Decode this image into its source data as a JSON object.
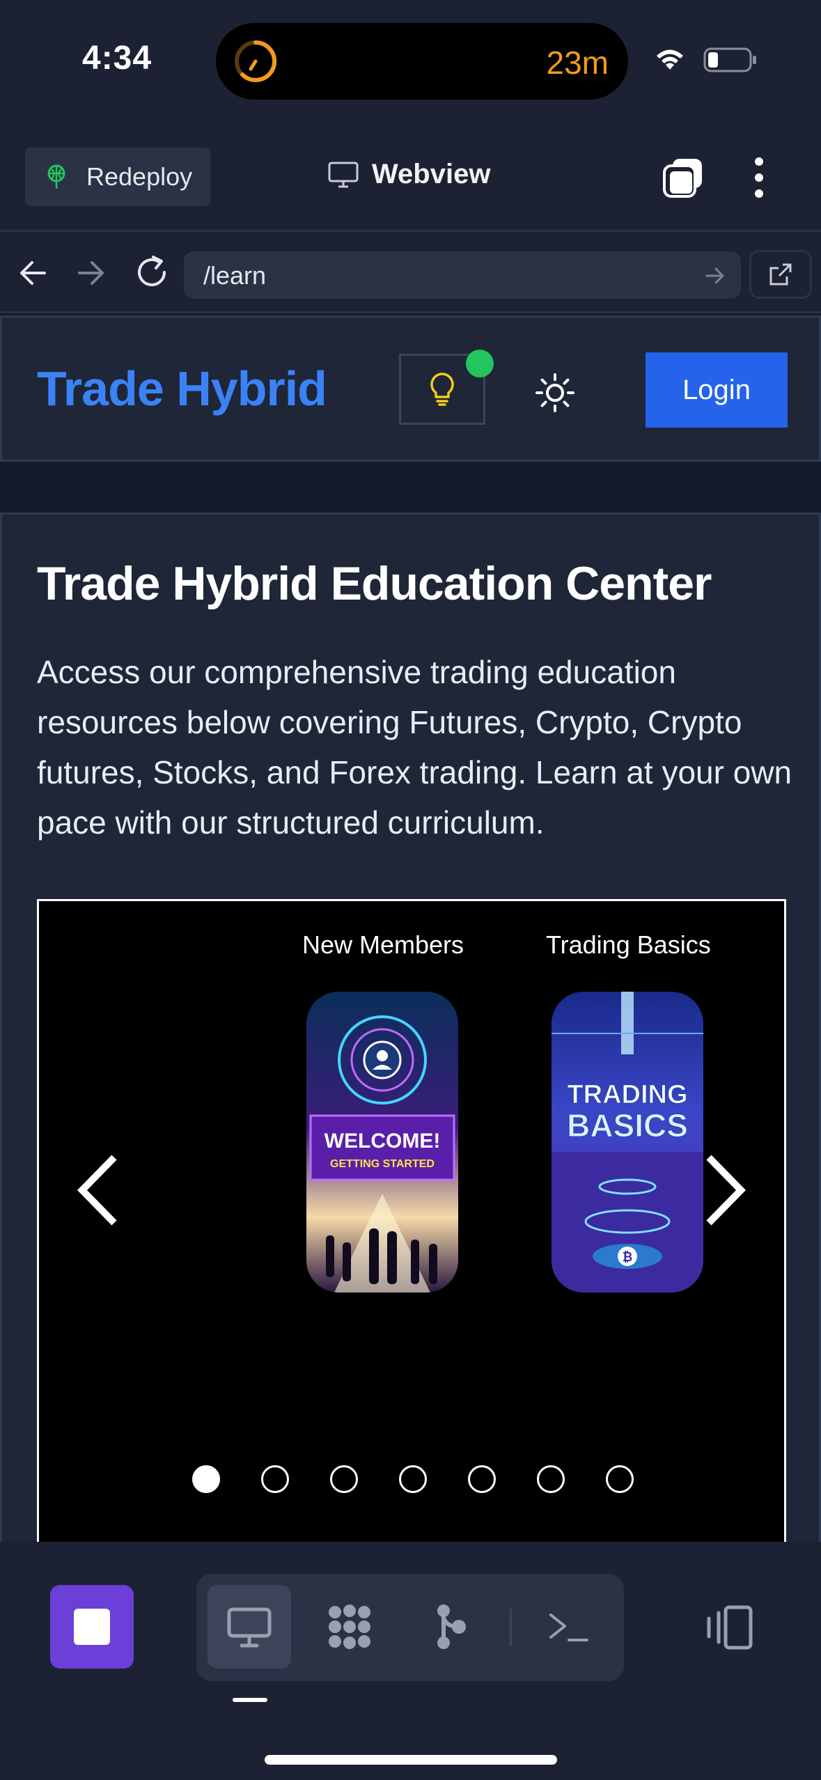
{
  "status_bar": {
    "time": "4:34",
    "timer": "23m",
    "timer_color": "#f39a1c"
  },
  "replit_bar": {
    "redeploy_label": "Redeploy",
    "webview_label": "Webview",
    "icons": [
      "redeploy-icon",
      "monitor-icon",
      "tabs-icon",
      "more-vertical-icon"
    ]
  },
  "url_bar": {
    "url": "/learn",
    "icons": [
      "back-arrow-icon",
      "forward-arrow-icon",
      "reload-icon",
      "go-arrow-icon",
      "open-external-icon"
    ]
  },
  "site_header": {
    "brand": "Trade Hybrid",
    "login_label": "Login",
    "brand_color": "#3b82f6",
    "login_color": "#2563eb",
    "notification_color": "#22c55e"
  },
  "main": {
    "title": "Trade Hybrid Education Center",
    "intro": "Access our comprehensive trading education resources below covering Futures, Crypto, Crypto futures, Stocks, and Forex trading. Learn at your own pace with our structured curriculum."
  },
  "carousel": {
    "slides": [
      {
        "label": "New Members",
        "card_text_1": "WELCOME!",
        "card_text_2": "GETTING STARTED"
      },
      {
        "label": "Trading Basics",
        "card_text_1": "TRADING",
        "card_text_2": "BASICS"
      }
    ],
    "dot_count": 7,
    "active_index": 0
  },
  "toolbar": {
    "accent": "#6b3fd8",
    "icons": [
      "stop-icon",
      "monitor-icon",
      "apps-grid-icon",
      "git-branch-icon",
      "terminal-icon",
      "devices-icon"
    ]
  }
}
